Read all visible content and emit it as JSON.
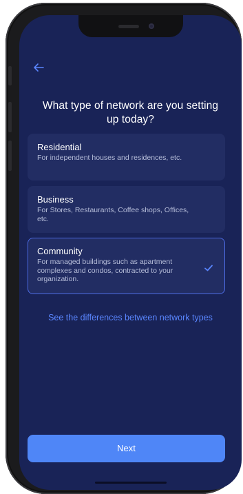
{
  "header": {
    "title": "What type of network are you setting up today?"
  },
  "options": [
    {
      "title": "Residential",
      "description": "For independent houses and residences, etc.",
      "selected": false
    },
    {
      "title": "Business",
      "description": "For Stores, Restaurants, Coffee shops, Offices, etc.",
      "selected": false
    },
    {
      "title": "Community",
      "description": "For managed buildings such as apartment complexes and condos, contracted to your organization.",
      "selected": true
    }
  ],
  "link": {
    "label": "See the differences between network types"
  },
  "footer": {
    "next_label": "Next"
  },
  "icons": {
    "back": "back-arrow-icon",
    "check": "checkmark-icon"
  },
  "colors": {
    "background": "#192357",
    "card": "#222d63",
    "accent": "#4f86f7",
    "link": "#5a86ff",
    "selected_border": "#4d6be3"
  }
}
